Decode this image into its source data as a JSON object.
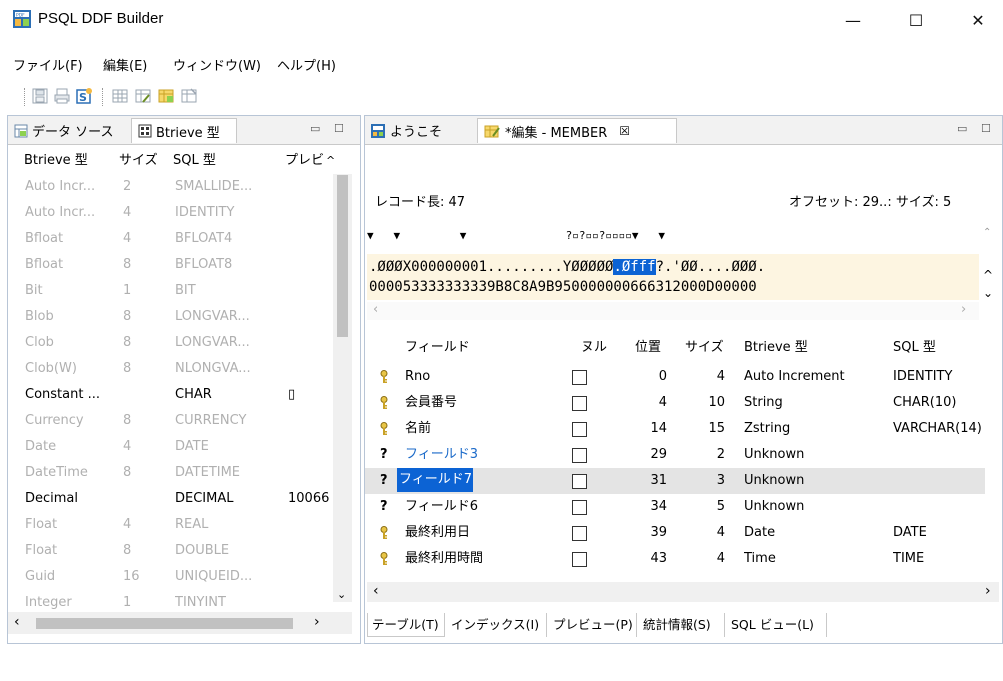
{
  "window": {
    "title": "PSQL DDF Builder",
    "min": "—",
    "max": "☐",
    "close": "✕"
  },
  "menu": [
    "ファイル(F)",
    "編集(E)",
    "ウィンドウ(W)",
    "ヘルプ(H)"
  ],
  "left_panel": {
    "tabs": [
      {
        "label": "データ ソース"
      },
      {
        "label": "Btrieve 型"
      }
    ],
    "headers": [
      "Btrieve 型",
      "サイズ",
      "SQL 型",
      "プレビュ"
    ],
    "rows": [
      {
        "type": "Auto Incr...",
        "size": "2",
        "sql": "SMALLIDE...",
        "preview": "",
        "dim": true
      },
      {
        "type": "Auto Incr...",
        "size": "4",
        "sql": "IDENTITY",
        "preview": "",
        "dim": true
      },
      {
        "type": "Bfloat",
        "size": "4",
        "sql": "BFLOAT4",
        "preview": "",
        "dim": true
      },
      {
        "type": "Bfloat",
        "size": "8",
        "sql": "BFLOAT8",
        "preview": "",
        "dim": true
      },
      {
        "type": "Bit",
        "size": "1",
        "sql": "BIT",
        "preview": "",
        "dim": true
      },
      {
        "type": "Blob",
        "size": "8",
        "sql": "LONGVAR...",
        "preview": "",
        "dim": true
      },
      {
        "type": "Clob",
        "size": "8",
        "sql": "LONGVAR...",
        "preview": "",
        "dim": true
      },
      {
        "type": "Clob(W)",
        "size": "8",
        "sql": "NLONGVA...",
        "preview": "",
        "dim": true
      },
      {
        "type": "Constant ...",
        "size": "",
        "sql": "CHAR",
        "preview": "▯",
        "dim": false
      },
      {
        "type": "Currency",
        "size": "8",
        "sql": "CURRENCY",
        "preview": "",
        "dim": true
      },
      {
        "type": "Date",
        "size": "4",
        "sql": "DATE",
        "preview": "",
        "dim": true
      },
      {
        "type": "DateTime",
        "size": "8",
        "sql": "DATETIME",
        "preview": "",
        "dim": true
      },
      {
        "type": "Decimal",
        "size": "",
        "sql": "DECIMAL",
        "preview": "10066",
        "dim": false
      },
      {
        "type": "Float",
        "size": "4",
        "sql": "REAL",
        "preview": "",
        "dim": true
      },
      {
        "type": "Float",
        "size": "8",
        "sql": "DOUBLE",
        "preview": "",
        "dim": true
      },
      {
        "type": "Guid",
        "size": "16",
        "sql": "UNIQUEID...",
        "preview": "",
        "dim": true
      },
      {
        "type": "Integer",
        "size": "1",
        "sql": "TINYINT",
        "preview": "",
        "dim": true
      }
    ]
  },
  "editor": {
    "tabs": [
      {
        "label": "ようこそ"
      },
      {
        "label": "*編集 - MEMBER"
      }
    ],
    "tab_close": "☒",
    "record_length_label": "レコード長: 47",
    "offset_label": "オフセット: 29..: サイズ: 5",
    "markers": "▼   ▼         ▼               ?▫?▫▫?▫▫▫▫▼   ▼",
    "hex_line1_pre": ".ØØØX000000001.........YØØØØØ",
    "hex_line1_sel": ".Øfff",
    "hex_line1_post": "?.'ØØ....ØØØ.",
    "hex_line2": "000053333333339B8C8A9B950000000666312000D00000",
    "field_headers": [
      "フィールド",
      "ヌル",
      "位置",
      "サイズ",
      "Btrieve 型",
      "SQL 型"
    ],
    "fields": [
      {
        "icon": "key",
        "name": "Rno",
        "pos": "0",
        "size": "4",
        "btype": "Auto Increment",
        "sql": "IDENTITY",
        "style": ""
      },
      {
        "icon": "key",
        "name": "会員番号",
        "pos": "4",
        "size": "10",
        "btype": "String",
        "sql": "CHAR(10)",
        "style": ""
      },
      {
        "icon": "key",
        "name": "名前",
        "pos": "14",
        "size": "15",
        "btype": "Zstring",
        "sql": "VARCHAR(14)",
        "style": ""
      },
      {
        "icon": "?",
        "name": "フィールド3",
        "pos": "29",
        "size": "2",
        "btype": "Unknown",
        "sql": "",
        "style": "link"
      },
      {
        "icon": "?",
        "name": "フィールド7",
        "pos": "31",
        "size": "3",
        "btype": "Unknown",
        "sql": "",
        "style": "selected"
      },
      {
        "icon": "?",
        "name": "フィールド6",
        "pos": "34",
        "size": "5",
        "btype": "Unknown",
        "sql": "",
        "style": ""
      },
      {
        "icon": "key",
        "name": "最終利用日",
        "pos": "39",
        "size": "4",
        "btype": "Date",
        "sql": "DATE",
        "style": ""
      },
      {
        "icon": "key",
        "name": "最終利用時間",
        "pos": "43",
        "size": "4",
        "btype": "Time",
        "sql": "TIME",
        "style": ""
      }
    ],
    "bottom_tabs": [
      "テーブル(T)",
      "インデックス(I)",
      "プレビュー(P)",
      "統計情報(S)",
      "SQL ビュー(L)"
    ]
  }
}
